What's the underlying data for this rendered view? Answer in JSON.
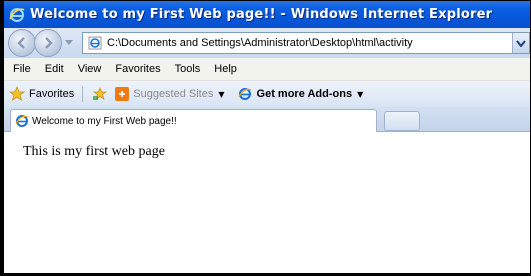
{
  "window": {
    "title": "Welcome to my First Web page!! - Windows Internet Explorer"
  },
  "address_bar": {
    "url": "C:\\Documents and Settings\\Administrator\\Desktop\\html\\activity"
  },
  "menu": {
    "items": [
      "File",
      "Edit",
      "View",
      "Favorites",
      "Tools",
      "Help"
    ]
  },
  "favorites_bar": {
    "favorites_label": "Favorites",
    "suggested_sites_label": "Suggested Sites",
    "get_addons_label": "Get more Add-ons"
  },
  "tabs": {
    "active_tab_title": "Welcome to my First Web page!!"
  },
  "page": {
    "body_text": "This is my first web page"
  },
  "colors": {
    "titlebar": "#0a5fe0",
    "suggested_icon": "#f07a12"
  }
}
